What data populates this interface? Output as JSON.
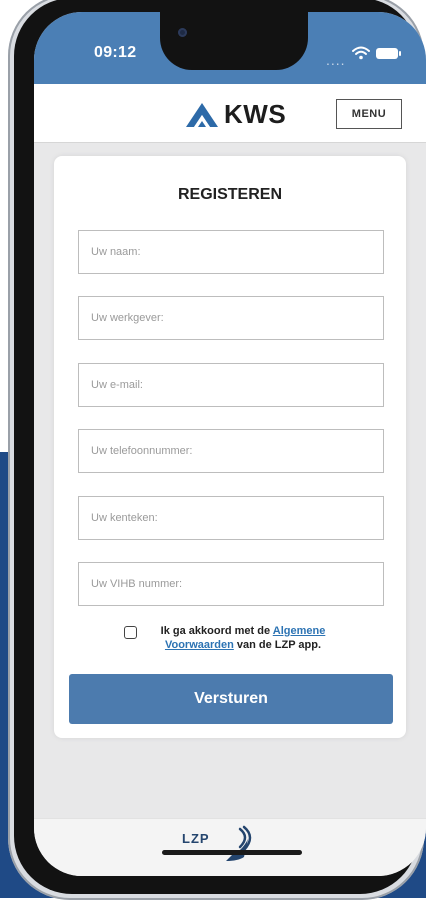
{
  "status_bar": {
    "time": "09:12",
    "signal": "...."
  },
  "header": {
    "brand": "KWS",
    "menu_label": "MENU"
  },
  "form": {
    "title": "REGISTEREN",
    "fields": [
      {
        "placeholder": "Uw naam:",
        "value": ""
      },
      {
        "placeholder": "Uw werkgever:",
        "value": ""
      },
      {
        "placeholder": "Uw e-mail:",
        "value": ""
      },
      {
        "placeholder": "Uw telefoonnummer:",
        "value": ""
      },
      {
        "placeholder": "Uw kenteken:",
        "value": ""
      },
      {
        "placeholder": "Uw VIHB nummer:",
        "value": ""
      }
    ],
    "agree_prefix": "Ik ga akkoord met de",
    "agree_link": "Algemene Voorwaarden",
    "agree_suffix": "van de LZP app.",
    "agree_checked": false,
    "submit_label": "Versturen"
  },
  "footer": {
    "logo_text": "LZP"
  },
  "colors": {
    "status_bar": "#4b7fb5",
    "button": "#4c7bae",
    "link": "#2c73b3",
    "background_accent": "#1f4a86"
  }
}
